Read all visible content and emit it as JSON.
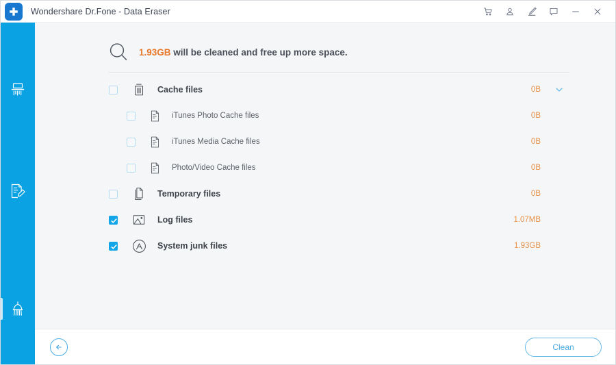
{
  "window": {
    "title": "Wondershare Dr.Fone - Data Eraser",
    "logo_icon": "dr-fone-plus-logo",
    "controls": [
      {
        "name": "cart-icon",
        "label": "Store"
      },
      {
        "name": "account-icon",
        "label": "Account"
      },
      {
        "name": "edit-icon",
        "label": "Register"
      },
      {
        "name": "feedback-icon",
        "label": "Feedback"
      },
      {
        "name": "minimize-icon",
        "label": "Minimize"
      },
      {
        "name": "close-icon",
        "label": "Close"
      }
    ]
  },
  "sidebar": {
    "background": "#0ba2e4",
    "items": [
      {
        "name": "sidebar-item-erase-all-data",
        "icon": "shredder-icon",
        "label": "Erase All Data",
        "active": false
      },
      {
        "name": "sidebar-item-erase-private-data",
        "icon": "document-pencil-icon",
        "label": "Erase Private Data",
        "active": false
      },
      {
        "name": "sidebar-item-free-up-space",
        "icon": "broom-icon",
        "label": "Free Up Space",
        "active": true
      }
    ]
  },
  "header": {
    "search_icon": "magnifier-icon",
    "amount": "1.93GB",
    "message": " will be cleaned and free up more space.",
    "amount_color": "#e8792b"
  },
  "rows": [
    {
      "name": "row-cache-files",
      "label": "Cache files",
      "icon": "trash-icon",
      "size": "0B",
      "checked": false,
      "expandable": true,
      "expanded": true,
      "chevron": "chevron-down-icon",
      "children": [
        {
          "name": "row-itunes-photo-cache-files",
          "label": "iTunes Photo Cache files",
          "icon": "file-lines-icon",
          "size": "0B",
          "checked": false
        },
        {
          "name": "row-itunes-media-cache-files",
          "label": "iTunes Media Cache files",
          "icon": "file-lines-icon",
          "size": "0B",
          "checked": false
        },
        {
          "name": "row-photo-video-cache-files",
          "label": "Photo/Video Cache files",
          "icon": "file-lines-icon",
          "size": "0B",
          "checked": false
        }
      ]
    },
    {
      "name": "row-temporary-files",
      "label": "Temporary files",
      "icon": "pages-icon",
      "size": "0B",
      "checked": false,
      "expandable": false,
      "children": []
    },
    {
      "name": "row-log-files",
      "label": "Log files",
      "icon": "photo-icon",
      "size": "1.07MB",
      "checked": true,
      "expandable": false,
      "children": []
    },
    {
      "name": "row-system-junk-files",
      "label": "System junk files",
      "icon": "appstore-circle-a-icon",
      "size": "1.93GB",
      "checked": true,
      "expandable": false,
      "children": []
    }
  ],
  "footer": {
    "back_icon": "arrow-left-circle-icon",
    "clean_label": "Clean"
  },
  "colors": {
    "accent_blue": "#0ba2e4",
    "size_orange": "#e8924a",
    "checkbox_on": "#12a6e8"
  }
}
